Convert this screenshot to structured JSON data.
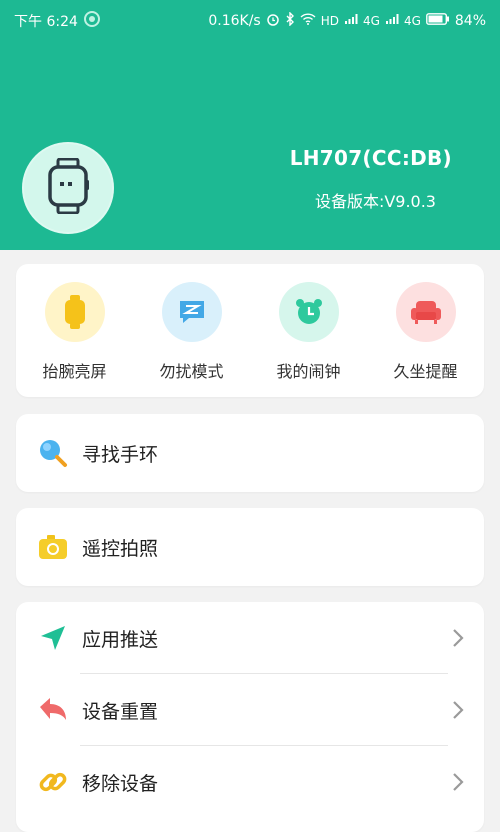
{
  "status_bar": {
    "time": "下午 6:24",
    "net_speed": "0.16K/s",
    "hd": "HD",
    "net1": "4G",
    "net2": "4G",
    "battery": "84%"
  },
  "device": {
    "name": "LH707(CC:DB)",
    "version_label": "设备版本:V9.0.3"
  },
  "quick_actions": [
    {
      "label": "抬腕亮屏",
      "icon": "watch-icon",
      "color": "#f5c21a",
      "bg": "#fff4c8"
    },
    {
      "label": "勿扰模式",
      "icon": "dnd-message-icon",
      "color": "#43a8e6",
      "bg": "#d9f0fb"
    },
    {
      "label": "我的闹钟",
      "icon": "alarm-clock-icon",
      "color": "#2ec99d",
      "bg": "#d6f6ec"
    },
    {
      "label": "久坐提醒",
      "icon": "sofa-icon",
      "color": "#ef5a5a",
      "bg": "#fde0e0"
    }
  ],
  "find_band": {
    "label": "寻找手环",
    "icon": "search-icon"
  },
  "remote_camera": {
    "label": "遥控拍照",
    "icon": "camera-icon"
  },
  "settings_list": [
    {
      "label": "应用推送",
      "icon": "send-arrow-icon"
    },
    {
      "label": "设备重置",
      "icon": "reset-arrow-icon"
    },
    {
      "label": "移除设备",
      "icon": "link-icon"
    }
  ]
}
